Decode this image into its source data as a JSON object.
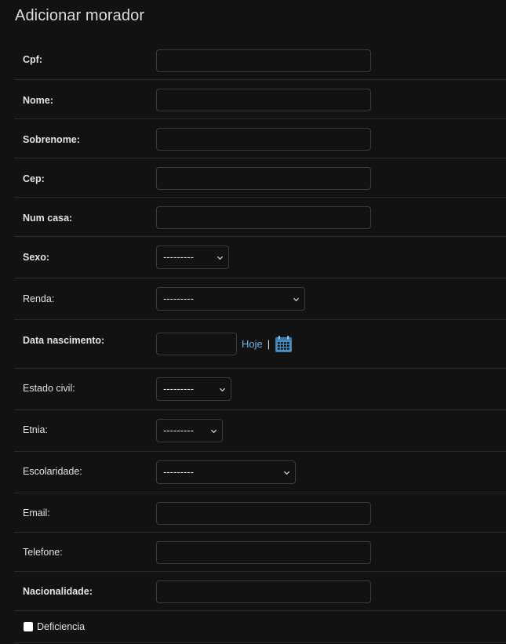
{
  "page": {
    "title": "Adicionar morador"
  },
  "form": {
    "cpf": {
      "label": "Cpf:",
      "value": ""
    },
    "nome": {
      "label": "Nome:",
      "value": ""
    },
    "sobrenome": {
      "label": "Sobrenome:",
      "value": ""
    },
    "cep": {
      "label": "Cep:",
      "value": ""
    },
    "num_casa": {
      "label": "Num casa:",
      "value": ""
    },
    "sexo": {
      "label": "Sexo:",
      "selected": "---------"
    },
    "renda": {
      "label": "Renda:",
      "selected": "---------"
    },
    "data_nascimento": {
      "label": "Data nascimento:",
      "value": "",
      "today_link": "Hoje",
      "separator": "|",
      "icon": "calendar-icon"
    },
    "estado_civil": {
      "label": "Estado civil:",
      "selected": "---------"
    },
    "etnia": {
      "label": "Etnia:",
      "selected": "---------"
    },
    "escolaridade": {
      "label": "Escolaridade:",
      "selected": "---------"
    },
    "email": {
      "label": "Email:",
      "value": ""
    },
    "telefone": {
      "label": "Telefone:",
      "value": ""
    },
    "nacionalidade": {
      "label": "Nacionalidade:",
      "value": ""
    },
    "deficiencia": {
      "label": "Deficiencia",
      "checked": false
    }
  },
  "colors": {
    "background": "#121212",
    "border": "#3c3c3c",
    "row_divider": "#2a2a2a",
    "link": "#6fb4e6",
    "calendar_icon": "#4a8fc4"
  }
}
